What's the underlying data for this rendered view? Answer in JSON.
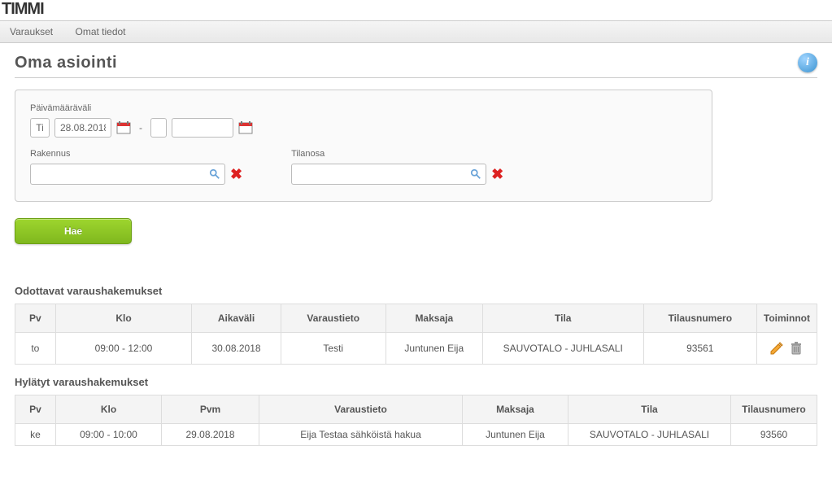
{
  "logo": "TIMMI",
  "nav": {
    "items": [
      "Varaukset",
      "Omat tiedot"
    ]
  },
  "page_title": "Oma asiointi",
  "search": {
    "date_range_label": "Päivämääräväli",
    "day_from": "Ti",
    "date_from": "28.08.2018",
    "dash": "-",
    "day_to": "",
    "date_to": "",
    "building_label": "Rakennus",
    "building_value": "",
    "roompart_label": "Tilanosa",
    "roompart_value": "",
    "search_button": "Hae"
  },
  "pending": {
    "title": "Odottavat varaushakemukset",
    "headers": [
      "Pv",
      "Klo",
      "Aikaväli",
      "Varaustieto",
      "Maksaja",
      "Tila",
      "Tilausnumero",
      "Toiminnot"
    ],
    "rows": [
      {
        "pv": "to",
        "klo": "09:00 - 12:00",
        "aikavali": "30.08.2018",
        "varaustieto": "Testi",
        "maksaja": "Juntunen Eija",
        "tila": "SAUVOTALO - JUHLASALI",
        "tilausnumero": "93561"
      }
    ]
  },
  "rejected": {
    "title": "Hylätyt varaushakemukset",
    "headers": [
      "Pv",
      "Klo",
      "Pvm",
      "Varaustieto",
      "Maksaja",
      "Tila",
      "Tilausnumero"
    ],
    "rows": [
      {
        "pv": "ke",
        "klo": "09:00 - 10:00",
        "pvm": "29.08.2018",
        "varaustieto": "Eija Testaa sähköistä hakua",
        "maksaja": "Juntunen Eija",
        "tila": "SAUVOTALO - JUHLASALI",
        "tilausnumero": "93560"
      }
    ]
  }
}
